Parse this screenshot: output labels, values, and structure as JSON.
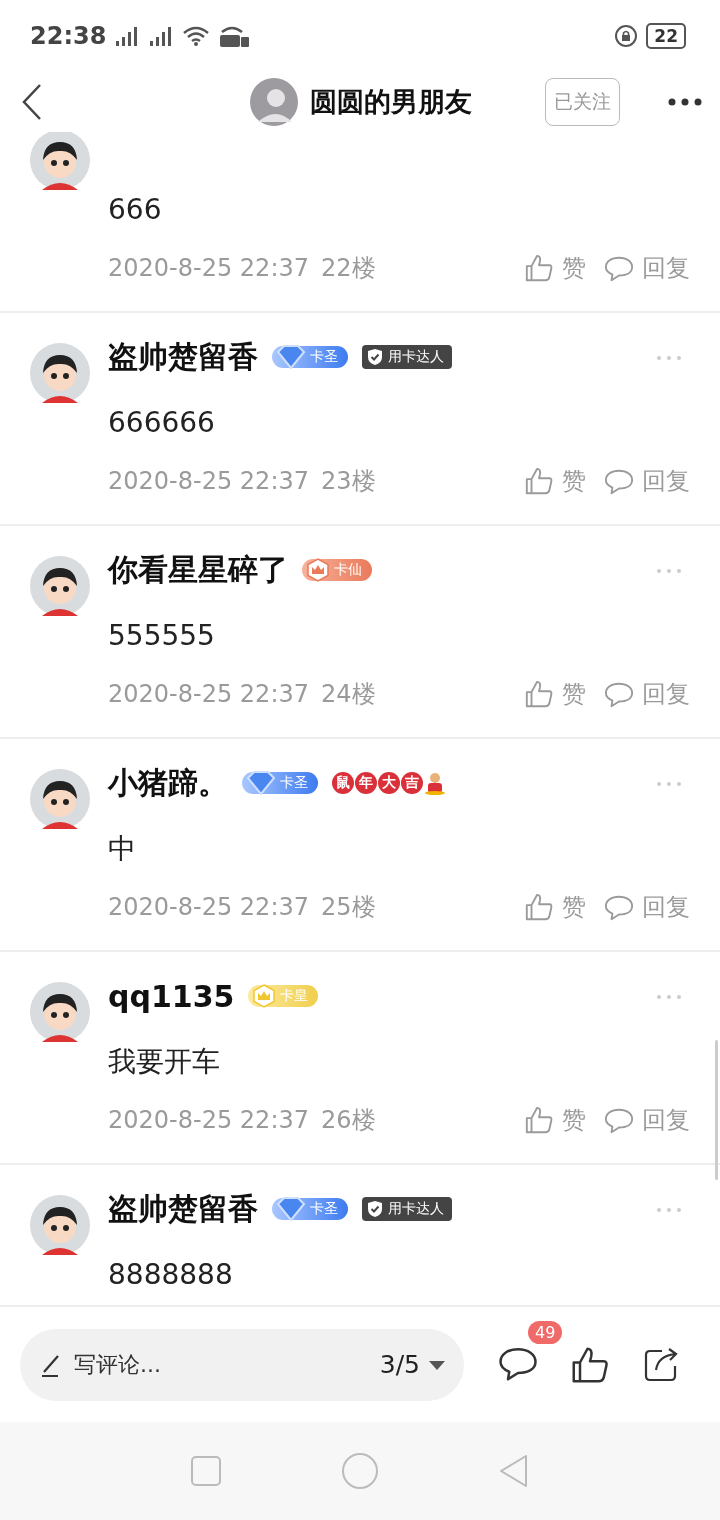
{
  "status_bar": {
    "time": "22:38",
    "battery": "22"
  },
  "header": {
    "title": "圆圆的男朋友",
    "follow_button": "已关注"
  },
  "comments": [
    {
      "body": "666",
      "time": "2020-8-25 22:37",
      "floor": "22楼",
      "like": "赞",
      "reply": "回复"
    },
    {
      "name": "盗帅楚留香",
      "body": "666666",
      "time": "2020-8-25 22:37",
      "floor": "23楼",
      "like": "赞",
      "reply": "回复",
      "badges": [
        {
          "kind": "diamond",
          "label": "卡圣"
        },
        {
          "kind": "dark",
          "label": "用卡达人"
        }
      ]
    },
    {
      "name": "你看星星碎了",
      "body": "555555",
      "time": "2020-8-25 22:37",
      "floor": "24楼",
      "like": "赞",
      "reply": "回复",
      "badges": [
        {
          "kind": "crown-orange",
          "label": "卡仙"
        }
      ]
    },
    {
      "name": "小猪蹄。",
      "body": "中",
      "time": "2020-8-25 22:37",
      "floor": "25楼",
      "like": "赞",
      "reply": "回复",
      "badges": [
        {
          "kind": "diamond",
          "label": "卡圣"
        },
        {
          "kind": "festival",
          "label": "鼠年大吉"
        }
      ]
    },
    {
      "name": "qq1135",
      "body": "我要开车",
      "time": "2020-8-25 22:37",
      "floor": "26楼",
      "like": "赞",
      "reply": "回复",
      "badges": [
        {
          "kind": "crown-gold",
          "label": "卡皇"
        }
      ]
    },
    {
      "name": "盗帅楚留香",
      "body": "8888888",
      "badges": [
        {
          "kind": "diamond",
          "label": "卡圣"
        },
        {
          "kind": "dark",
          "label": "用卡达人"
        }
      ]
    }
  ],
  "bottom_bar": {
    "placeholder": "写评论...",
    "page": "3/5",
    "comment_count": "49"
  }
}
